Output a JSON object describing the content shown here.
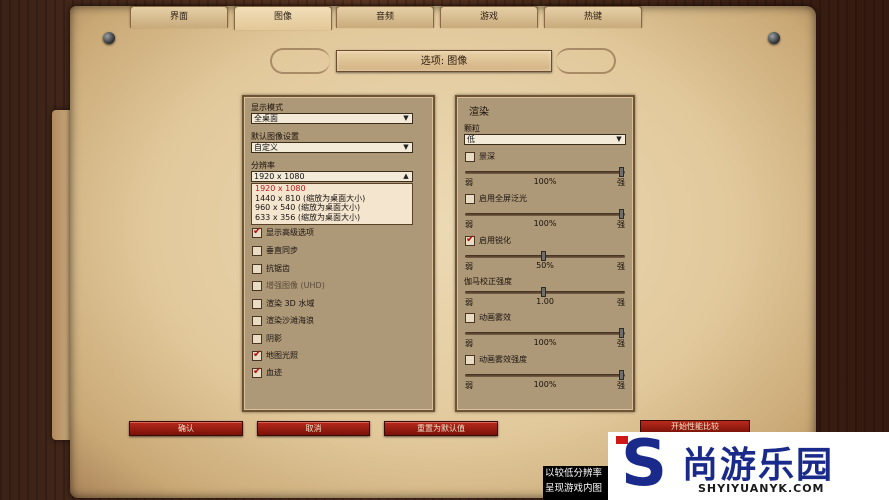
{
  "tabs": [
    {
      "label": "界面",
      "active": false
    },
    {
      "label": "图像",
      "active": true
    },
    {
      "label": "音频",
      "active": false
    },
    {
      "label": "游戏",
      "active": false
    },
    {
      "label": "热键",
      "active": false
    }
  ],
  "title": "选项: 图像",
  "left": {
    "display_mode_label": "显示模式",
    "display_mode_value": "全桌面",
    "default_image_label": "默认图像设置",
    "default_image_value": "自定义",
    "resolution_label": "分辨率",
    "resolution_value": "1920 x 1080",
    "resolution_options": [
      "1920 x 1080",
      "1440 x 810 (缩放为桌面大小)",
      "960 x 540 (缩放为桌面大小)",
      "633 x 356 (缩放为桌面大小)"
    ],
    "checkboxes": [
      {
        "label": "显示高级选项",
        "checked": true,
        "enabled": true
      },
      {
        "label": "垂直同步",
        "checked": false,
        "enabled": true
      },
      {
        "label": "抗锯齿",
        "checked": false,
        "enabled": true
      },
      {
        "label": "增强图像 (UHD)",
        "checked": false,
        "enabled": false
      },
      {
        "label": "渲染 3D 水域",
        "checked": false,
        "enabled": true
      },
      {
        "label": "渲染沙滩海浪",
        "checked": false,
        "enabled": true
      },
      {
        "label": "阴影",
        "checked": false,
        "enabled": true
      },
      {
        "label": "地图光照",
        "checked": true,
        "enabled": true
      },
      {
        "label": "血迹",
        "checked": true,
        "enabled": true
      }
    ]
  },
  "right": {
    "section_title": "渲染",
    "particles_label": "颗粒",
    "particles_value": "低",
    "weak_label": "弱",
    "strong_label": "强",
    "controls": [
      {
        "type": "checkbox",
        "label": "景深",
        "checked": false
      },
      {
        "type": "slider",
        "value_text": "100%",
        "level": 1.0
      },
      {
        "type": "checkbox",
        "label": "启用全屏泛光",
        "checked": false
      },
      {
        "type": "slider",
        "value_text": "100%",
        "level": 1.0
      },
      {
        "type": "checkbox",
        "label": "启用锐化",
        "checked": true
      },
      {
        "type": "slider",
        "value_text": "50%",
        "level": 0.5
      },
      {
        "type": "label",
        "label": "伽马校正强度"
      },
      {
        "type": "slider",
        "value_text": "1.00",
        "level": 0.5
      },
      {
        "type": "checkbox",
        "label": "动画雾效",
        "checked": false
      },
      {
        "type": "slider",
        "value_text": "100%",
        "level": 1.0
      },
      {
        "type": "checkbox",
        "label": "动画雾效强度",
        "checked": false
      },
      {
        "type": "slider",
        "value_text": "100%",
        "level": 1.0
      }
    ]
  },
  "buttons": {
    "confirm": "确认",
    "cancel": "取消",
    "reset": "重置为默认值",
    "benchmark": "开始性能比较"
  },
  "watermark": {
    "brand_cn": "尚游乐园",
    "brand_en": "SHYIYUANYK.COM",
    "caption_line1": "以较低分辨率",
    "caption_line2": "呈现游戏内图"
  }
}
